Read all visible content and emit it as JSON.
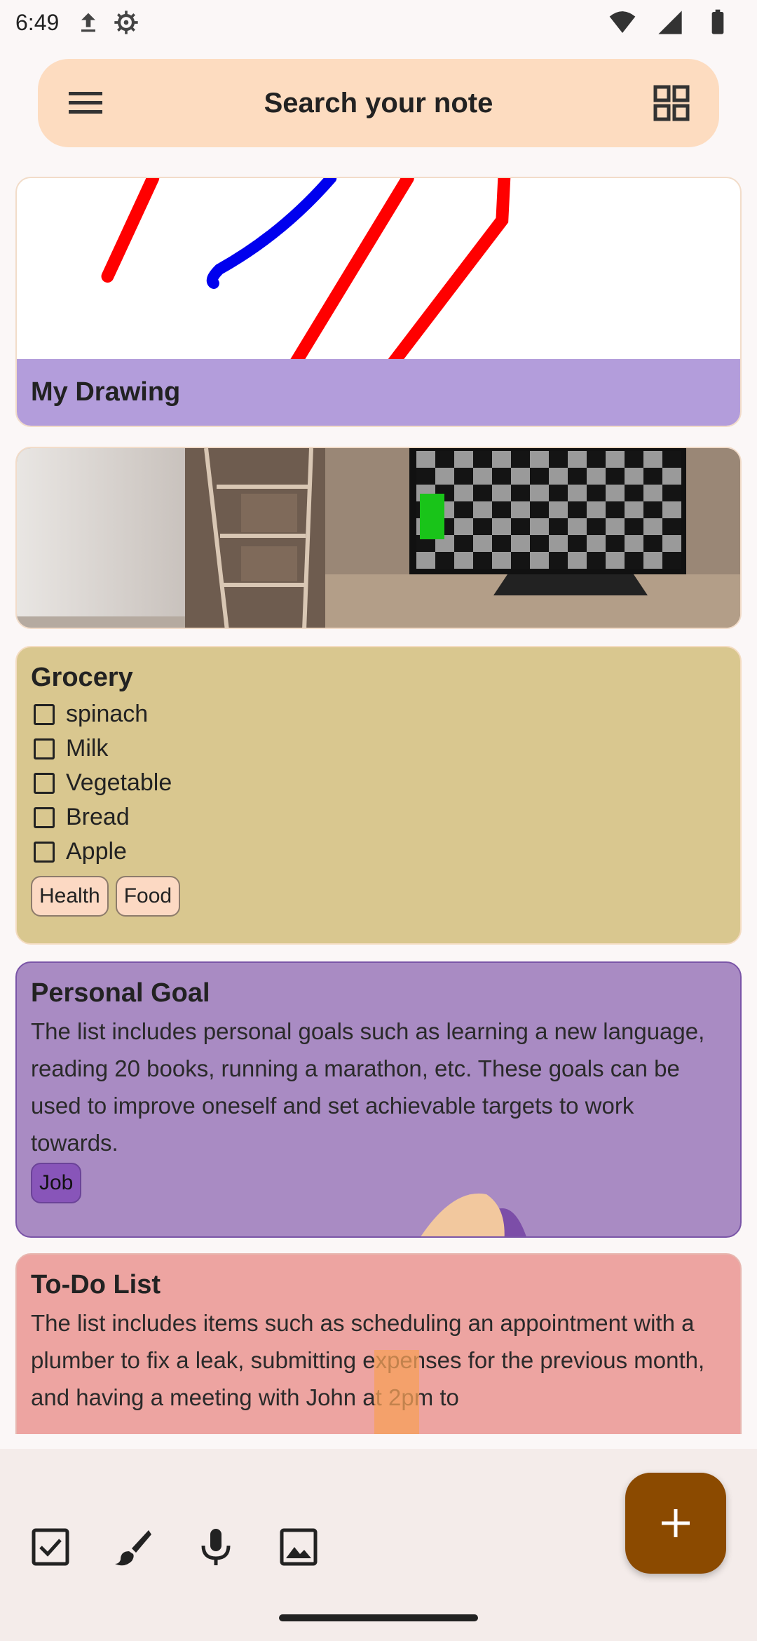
{
  "status_bar": {
    "time": "6:49"
  },
  "search": {
    "title": "Search your note"
  },
  "notes": {
    "drawing": {
      "title": "My Drawing"
    },
    "grocery": {
      "title": "Grocery",
      "items": [
        "spinach",
        "Milk",
        "Vegetable",
        "Bread",
        "Apple"
      ],
      "tags": [
        "Health",
        "Food"
      ]
    },
    "goal": {
      "title": "Personal Goal",
      "body": "The list includes personal goals such as learning a new language, reading 20 books, running a marathon, etc. These goals can be used to improve oneself and set achievable targets to work towards.",
      "tags": [
        "Job"
      ]
    },
    "todo": {
      "title": "To-Do List",
      "body": "The list includes items such as scheduling an appointment with a plumber to fix a leak, submitting expenses for the previous month, and having a meeting with John at 2pm to"
    }
  },
  "toolbar": {
    "icons": [
      "checkbox-icon",
      "brush-icon",
      "mic-icon",
      "image-icon"
    ],
    "fab_icon": "plus-icon"
  },
  "colors": {
    "search_bg": "#fddcc0",
    "drawing_footer": "#b39ddb",
    "grocery_bg": "#d9c78f",
    "goal_bg": "#a98bc3",
    "todo_bg": "#eda4a1",
    "fab_bg": "#8b4a00"
  }
}
